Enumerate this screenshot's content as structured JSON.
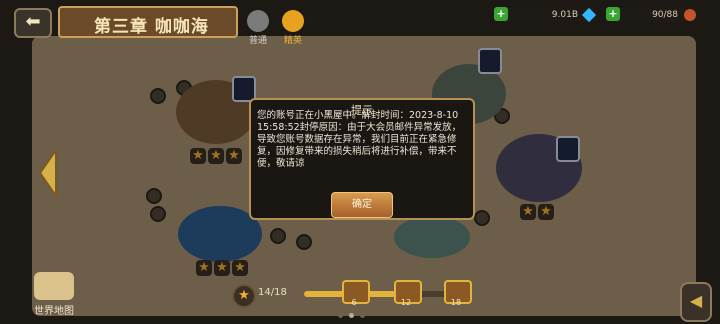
{
  "header": {
    "back_icon": "back-arrow-icon",
    "chapter_title": "第三章 咖咖海",
    "tabs": [
      {
        "label": "普通",
        "icon": "normal-mode-icon",
        "active": false
      },
      {
        "label": "精英",
        "icon": "elite-mode-icon",
        "active": true
      }
    ],
    "resources": [
      {
        "name": "gems",
        "value": "9.01B",
        "icon": "gem-icon"
      },
      {
        "name": "stamina",
        "value": "90/88",
        "icon": "drumstick-icon"
      }
    ]
  },
  "map": {
    "stages": [
      {
        "name": "ship-stage",
        "stars": 3
      },
      {
        "name": "whirlpool-stage",
        "stars": 3
      },
      {
        "name": "tower-stage",
        "stars": 0
      },
      {
        "name": "wreck-stage",
        "stars": 2
      },
      {
        "name": "fish-stage",
        "stars": 0
      }
    ]
  },
  "world_map": {
    "label": "世界地图",
    "icon": "world-map-icon"
  },
  "progress": {
    "count_text": "14/18",
    "fill": 0.78,
    "chests": [
      {
        "label": "6"
      },
      {
        "label": "12"
      },
      {
        "label": "18"
      }
    ]
  },
  "dialog": {
    "title": "提示",
    "body": "您的账号正在小黑屋中。解封时间：2023-8-10 15:58:52封停原因：由于大会员邮件异常发放，导致您账号数据存在异常，我们目前正在紧急修复，因修复带来的损失稍后将进行补偿，带来不便，敬请谅",
    "confirm_label": "确定"
  },
  "colors": {
    "accent": "#e3b33a",
    "dialog_border": "#b79153",
    "button": "#c2803e"
  }
}
